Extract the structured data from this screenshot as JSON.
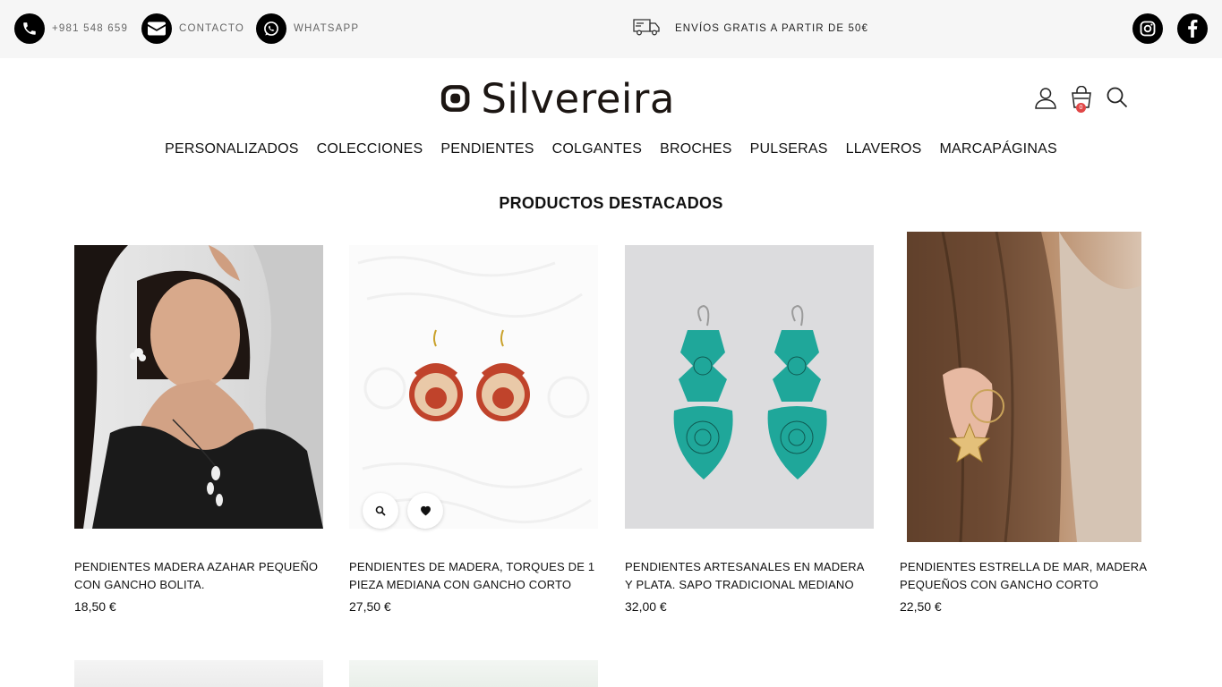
{
  "topbar": {
    "phone_label": "+981 548 659",
    "contact_label": "CONTACTO",
    "whatsapp_label": "WHATSAPP",
    "shipping_text": "ENVÍOS GRATIS A PARTIR DE 50€"
  },
  "header": {
    "logo_text": "Silvereira",
    "cart_count": "0"
  },
  "nav": {
    "items": [
      "PERSONALIZADOS",
      "COLECCIONES",
      "PENDIENTES",
      "COLGANTES",
      "BROCHES",
      "PULSERAS",
      "LLAVEROS",
      "MARCAPÁGINAS"
    ]
  },
  "featured": {
    "title": "PRODUCTOS DESTACADOS",
    "products": [
      {
        "name": "PENDIENTES MADERA AZAHAR PEQUEÑO CON GANCHO BOLITA.",
        "price": "18,50 €"
      },
      {
        "name": "PENDIENTES DE MADERA, TORQUES DE 1 PIEZA MEDIANA CON GANCHO CORTO",
        "price": "27,50 €"
      },
      {
        "name": "PENDIENTES ARTESANALES EN MADERA Y PLATA. SAPO TRADICIONAL MEDIANO",
        "price": "32,00 €"
      },
      {
        "name": "PENDIENTES ESTRELLA DE MAR, MADERA PEQUEÑOS CON GANCHO CORTO",
        "price": "22,50 €"
      }
    ]
  },
  "icons": {
    "phone": "phone-icon",
    "mail": "mail-icon",
    "whatsapp": "whatsapp-icon",
    "truck": "truck-icon",
    "instagram": "instagram-icon",
    "facebook": "facebook-icon",
    "user": "user-icon",
    "cart": "cart-icon",
    "search": "search-icon",
    "zoom": "zoom-icon",
    "heart": "heart-icon"
  },
  "colors": {
    "topbar_bg": "#f6f6f6",
    "badge": "#e04646",
    "turquoise": "#1fa79a"
  }
}
